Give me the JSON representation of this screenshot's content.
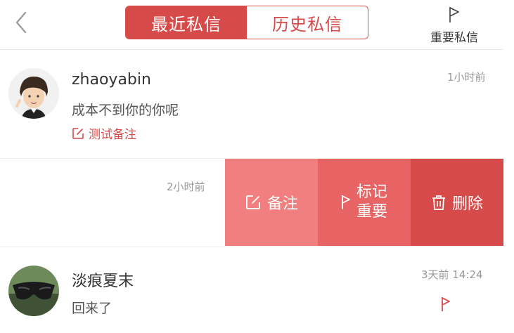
{
  "header": {
    "tabs": [
      {
        "label": "最近私信",
        "active": true
      },
      {
        "label": "历史私信",
        "active": false
      }
    ],
    "important_label": "重要私信",
    "icons": {
      "back": "chevron-left-icon",
      "important": "flag-outline-icon"
    }
  },
  "conversations": [
    {
      "name": "zhaoyabin",
      "message": "成本不到你的你呢",
      "note": "测试备注",
      "time": "1小时前"
    },
    {
      "time": "2小时前",
      "actions": {
        "note": "备注",
        "mark_line1": "标记",
        "mark_line2": "重要",
        "delete": "删除"
      }
    },
    {
      "name": "淡痕夏末",
      "message": "回来了",
      "time": "3天前 14:24",
      "important": true
    }
  ],
  "colors": {
    "accent": "#d64a4a",
    "action_note": "#f27f7f",
    "action_mark": "#e86363",
    "action_delete": "#d64a4a"
  }
}
